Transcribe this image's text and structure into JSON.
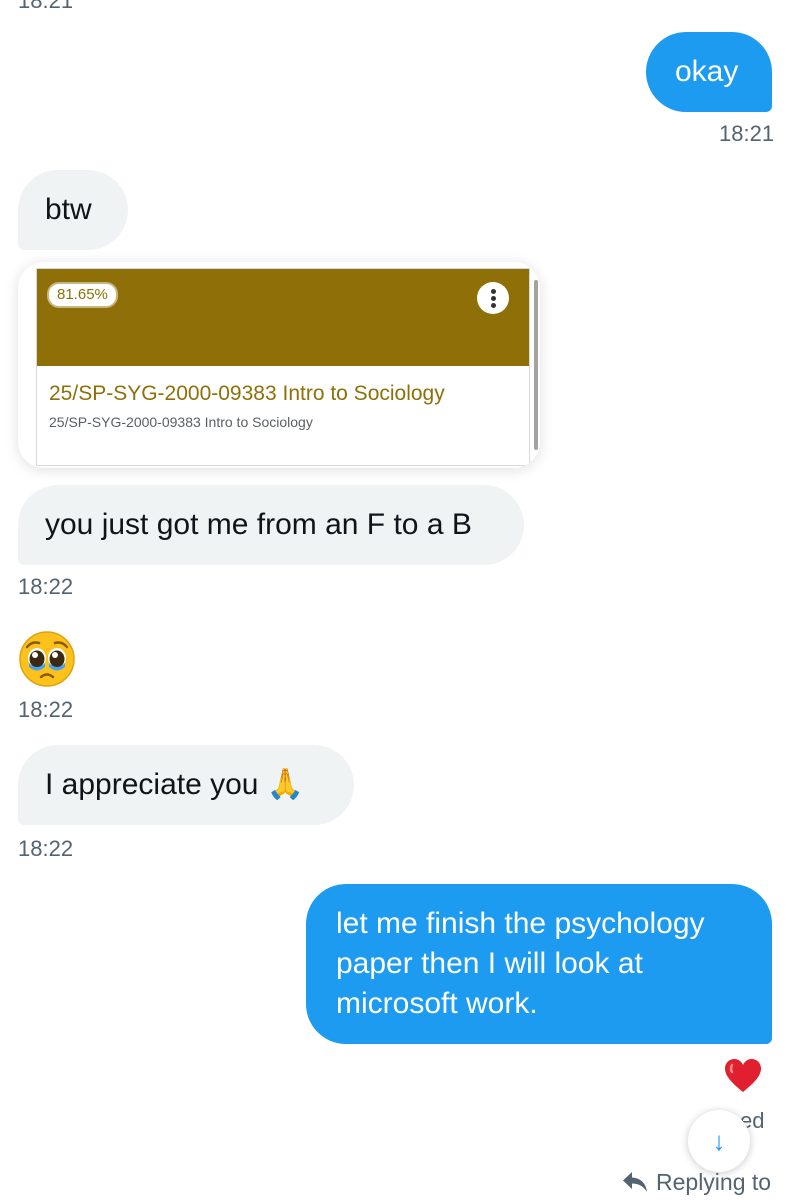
{
  "conversation": {
    "top_time_partial": "18:21",
    "messages": [
      {
        "from": "me",
        "text": "okay",
        "time": "18:21"
      },
      {
        "from": "them",
        "text": "btw"
      },
      {
        "from": "them",
        "attachment": {
          "grade": "81.65%",
          "course_title": "25/SP-SYG-2000-09383 Intro to Sociology",
          "course_subtitle": "25/SP-SYG-2000-09383 Intro to Sociology",
          "header_color": "#8f7008"
        }
      },
      {
        "from": "them",
        "text": "you just got me from an F to a B",
        "time": "18:22"
      },
      {
        "from": "them",
        "emoji": "pleading-face-with-tears",
        "time": "18:22"
      },
      {
        "from": "them",
        "text": "I appreciate you 🙏",
        "time": "18:22"
      },
      {
        "from": "me",
        "lines": [
          "let me finish the psychology",
          "paper then I will look at",
          "microsoft work."
        ],
        "reaction": "red-heart"
      }
    ]
  },
  "footer": {
    "seen_partial": "ed",
    "scroll_down_icon": "↓",
    "replying_to": "Replying to"
  },
  "colors": {
    "sent_bubble": "#1d9bf0",
    "received_bubble": "#eff3f4",
    "timestamp": "#536471"
  }
}
